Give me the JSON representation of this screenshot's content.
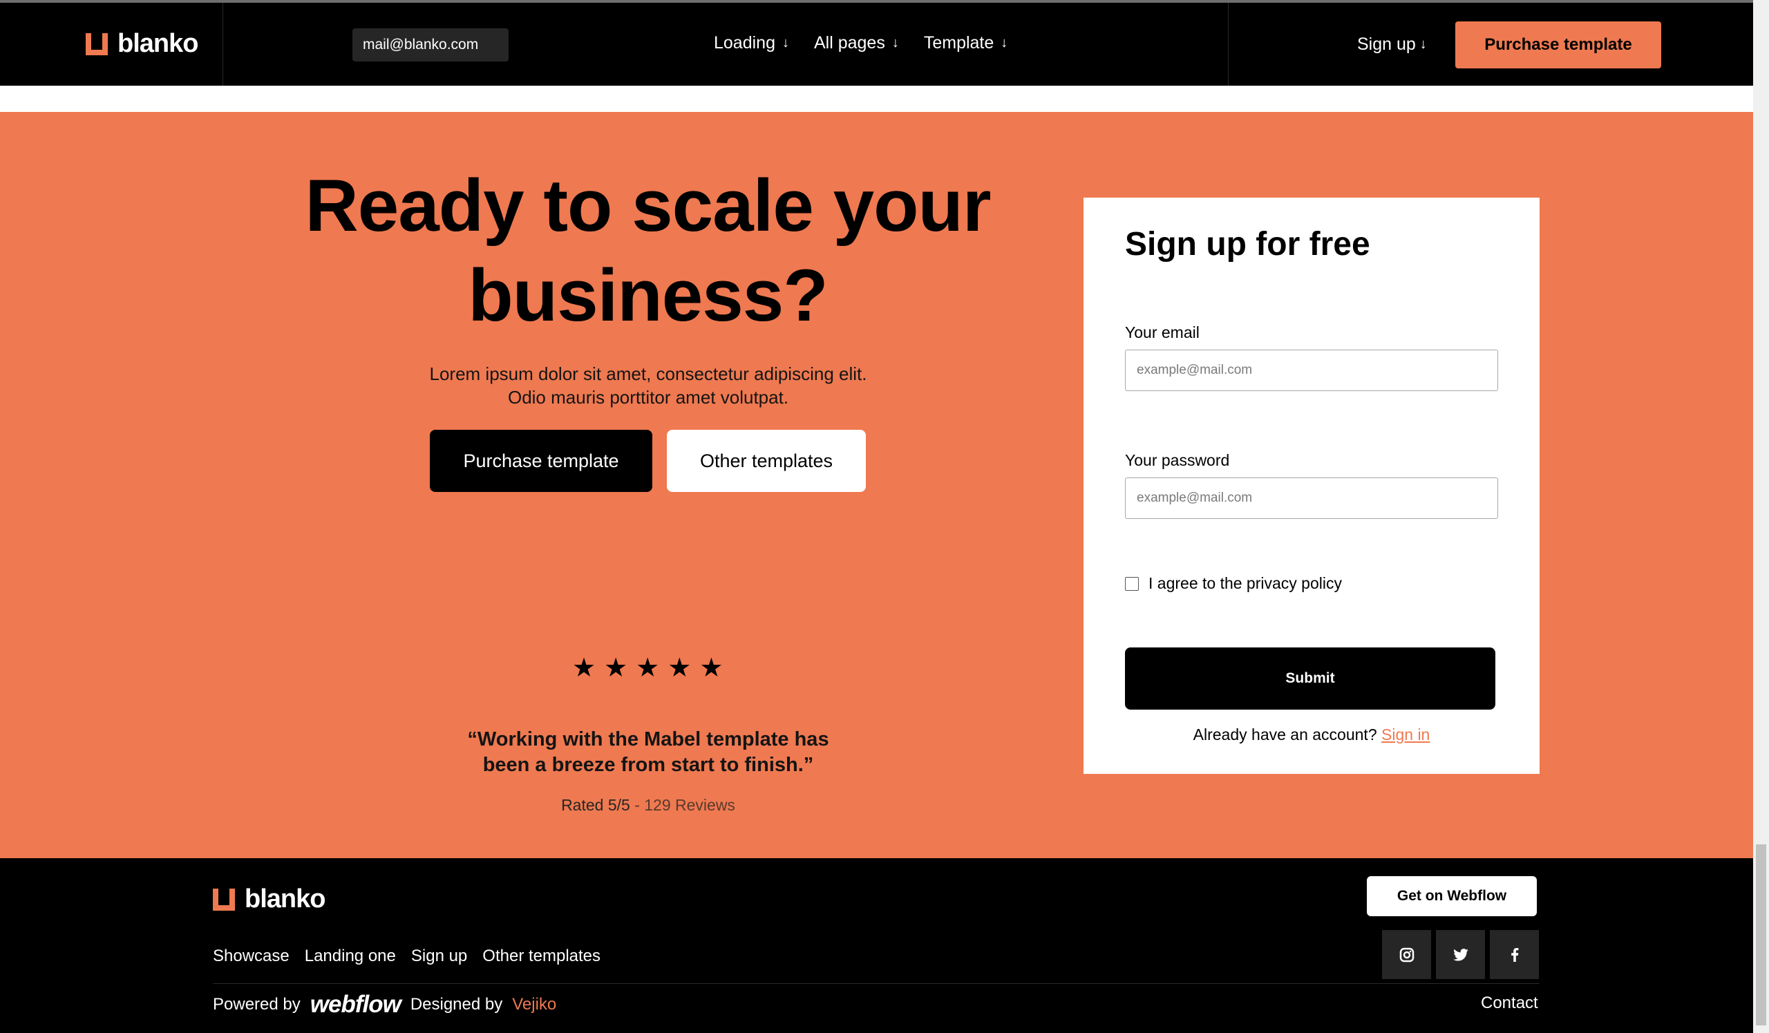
{
  "nav": {
    "logo_text": "blanko",
    "email_chip": "mail@blanko.com",
    "menu": [
      {
        "label": "Loading",
        "arrow": "↓"
      },
      {
        "label": "All pages",
        "arrow": "↓"
      },
      {
        "label": "Template",
        "arrow": "↓"
      }
    ],
    "signup_label": "Sign up",
    "signup_arrow": "↓",
    "cta_label": "Purchase template"
  },
  "hero": {
    "title_line1": "Ready to scale your",
    "title_line2": "business?",
    "subtitle_line1": "Lorem ipsum dolor sit amet, consectetur adipiscing elit.",
    "subtitle_line2": "Odio mauris porttitor amet volutpat.",
    "primary_button": "Purchase template",
    "secondary_button": "Other templates",
    "rating_stars": 5,
    "star_glyph": "★",
    "quote_line1": "“Working with the Mabel template has",
    "quote_line2": "been a breeze from start to finish.”",
    "rated_label": "Rated 5/5",
    "reviews_label": "- 129 Reviews"
  },
  "signup_form": {
    "title": "Sign up for free",
    "email_label": "Your email",
    "email_placeholder": "example@mail.com",
    "password_label": "Your password",
    "password_placeholder": "example@mail.com",
    "privacy_label": "I agree to the privacy policy",
    "privacy_checked": false,
    "submit_label": "Submit",
    "already_text": "Already have an account?",
    "signin_link": "Sign in"
  },
  "footer": {
    "logo_text": "blanko",
    "links": [
      "Showcase",
      "Landing one",
      "Sign up",
      "Other templates"
    ],
    "webflow_button": "Get on Webflow",
    "social_icons": [
      "instagram-icon",
      "twitter-icon",
      "facebook-icon"
    ],
    "powered_by": "Powered by",
    "webflow_logo": "webflow",
    "designed_by": "Designed by",
    "designer": "Vejiko",
    "contact": "Contact"
  },
  "colors": {
    "accent": "#ef7950",
    "dark": "#000000",
    "white": "#ffffff"
  },
  "scroll_position": 0.82
}
